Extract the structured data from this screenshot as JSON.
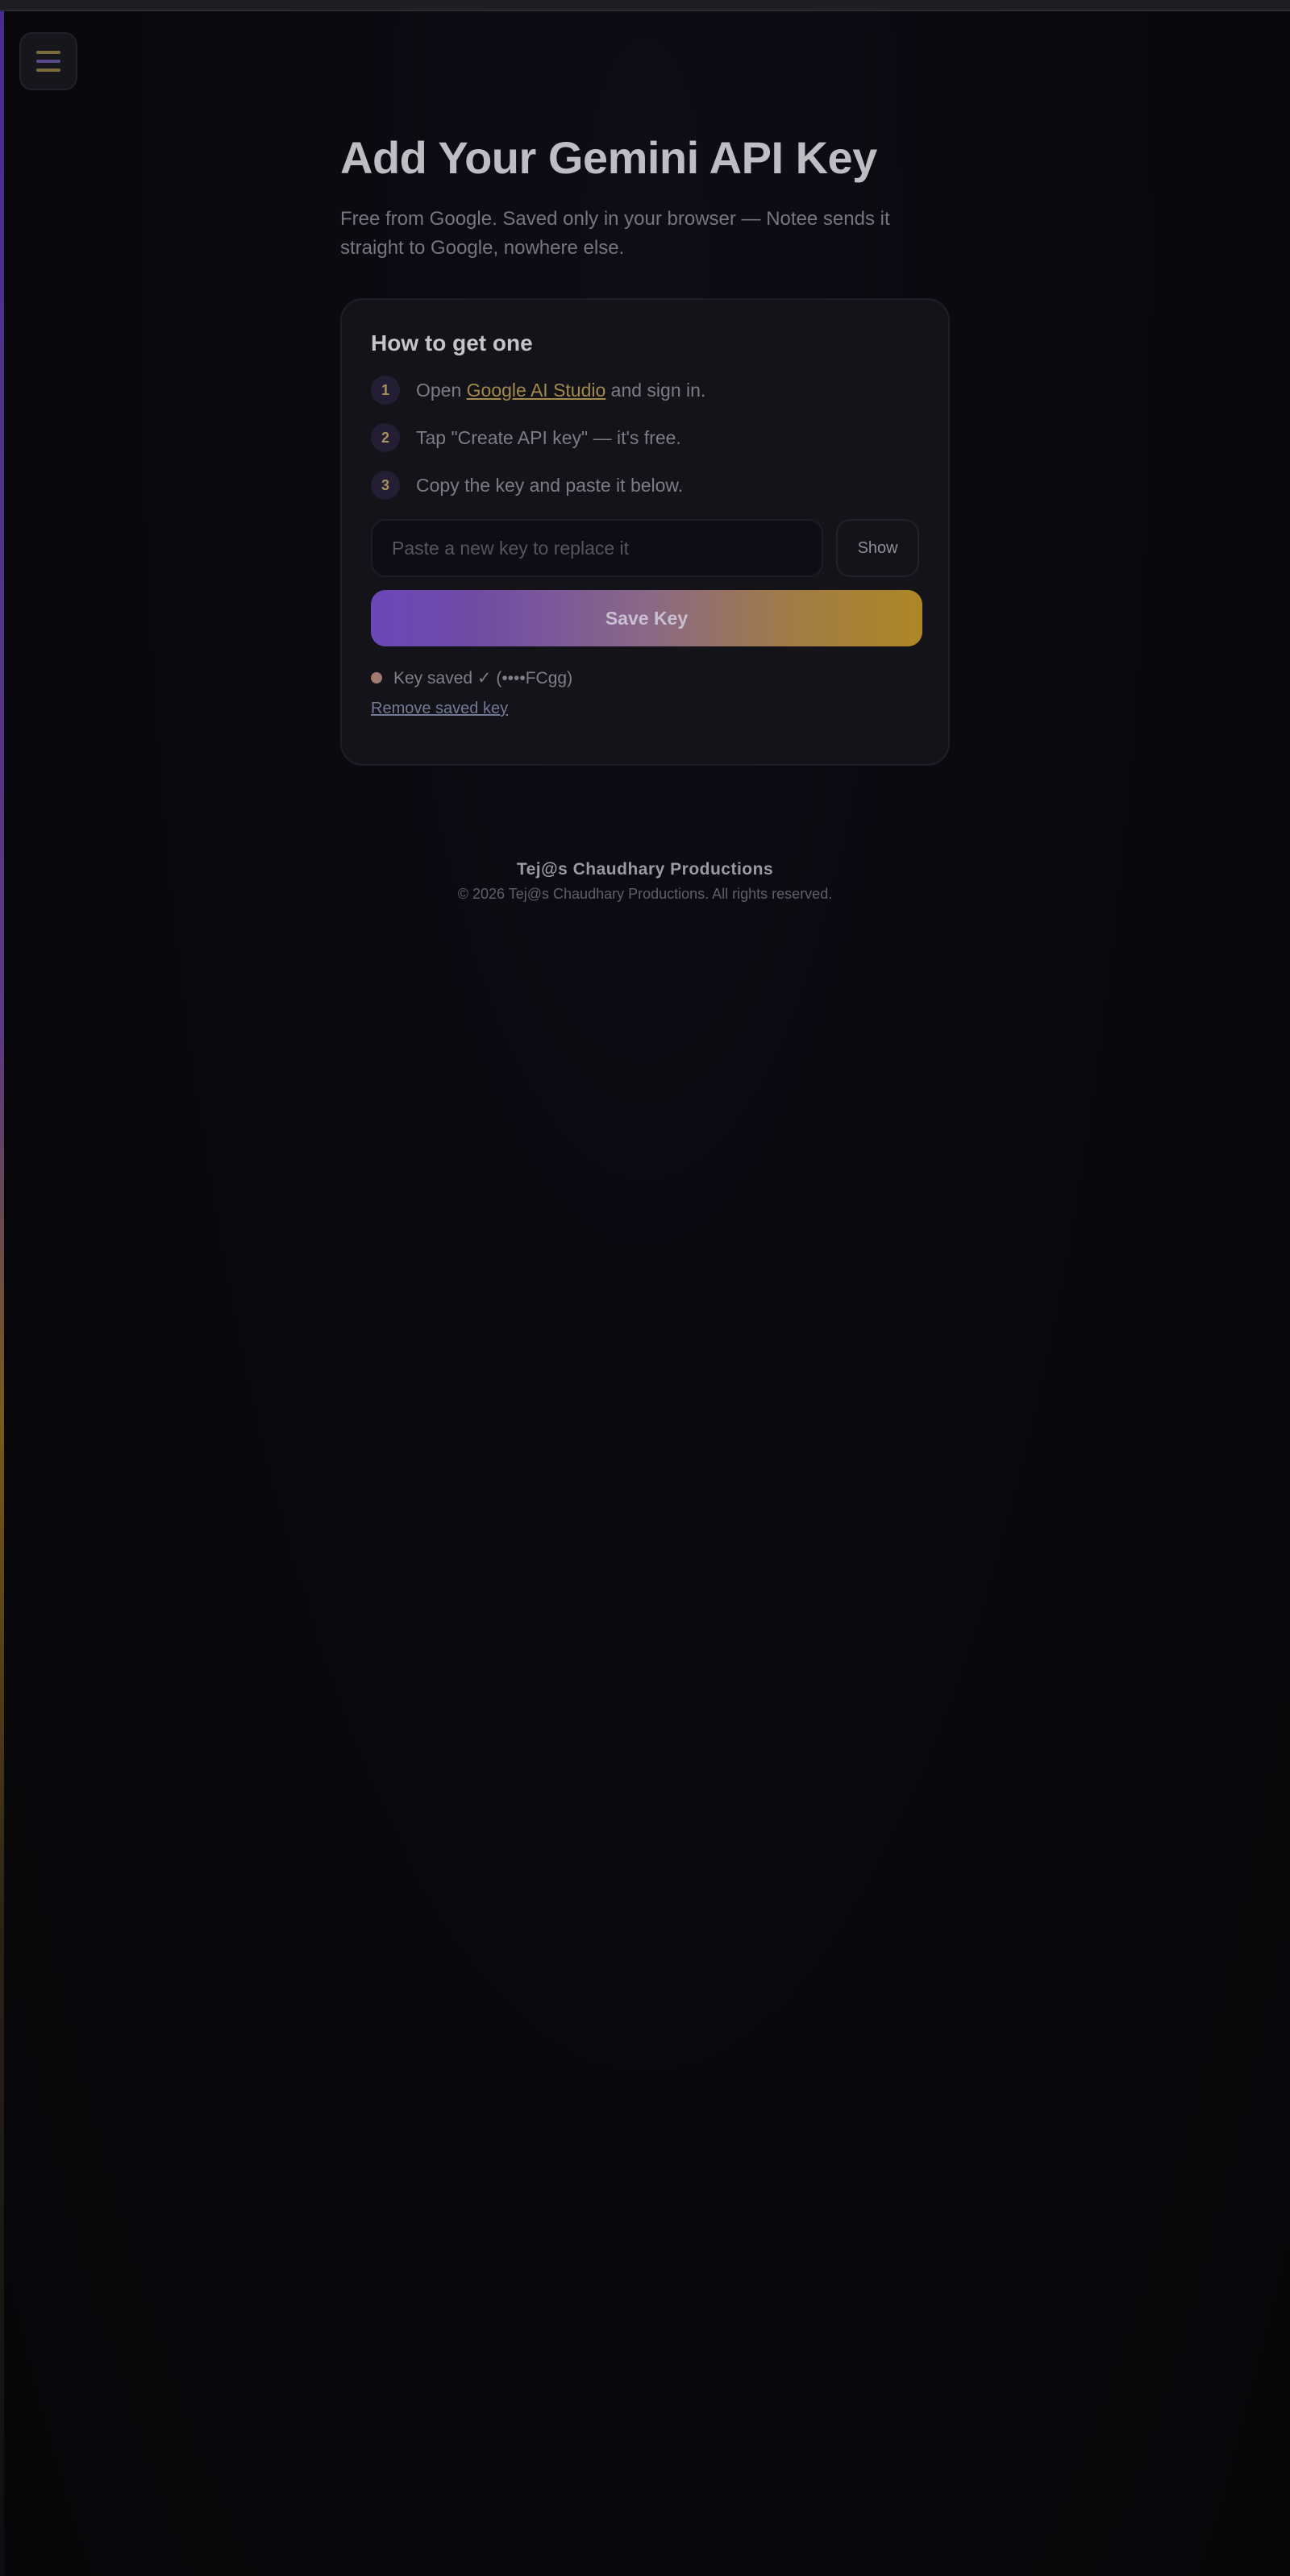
{
  "header": {
    "menu_icon": "hamburger-menu-icon"
  },
  "main": {
    "title": "Add Your Gemini API Key",
    "subtitle": "Free from Google. Saved only in your browser — Notee sends it straight to Google, nowhere else."
  },
  "card": {
    "heading": "How to get one",
    "steps": [
      {
        "number": "1",
        "before": "Open ",
        "link": "Google AI Studio",
        "after": " and sign in."
      },
      {
        "number": "2",
        "text": "Tap \"Create API key\" — it's free."
      },
      {
        "number": "3",
        "text": "Copy the key and paste it below."
      }
    ],
    "key_input": {
      "placeholder": "Paste a new key to replace it",
      "value": ""
    },
    "show_label": "Show",
    "save_label": "Save Key",
    "status_text": "Key saved ✓ (••••FCgg)",
    "remove_label": "Remove saved key"
  },
  "footer": {
    "brand": "Tej@s Chaudhary Productions",
    "copyright": "© 2026 Tej@s Chaudhary Productions. All rights reserved."
  },
  "colors": {
    "background": "#08080c",
    "card": "#141319",
    "accent_purple": "#6a48b8",
    "accent_gold": "#ad8725",
    "link_gold": "#a38a4a"
  }
}
